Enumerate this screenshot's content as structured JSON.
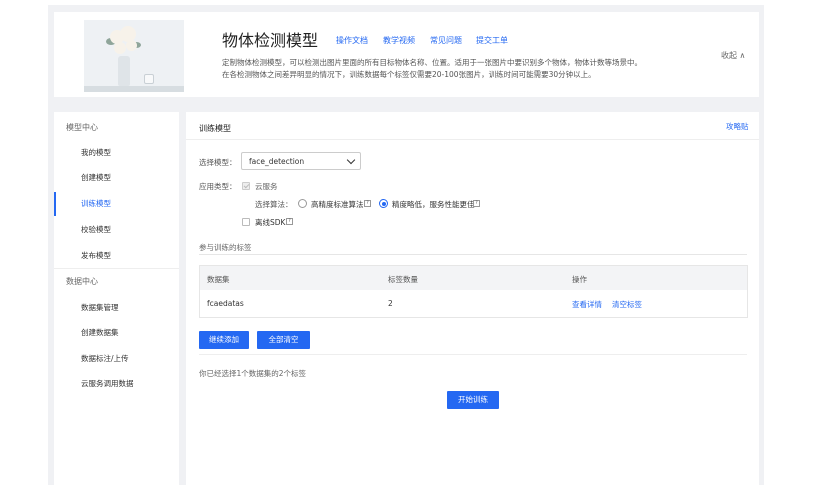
{
  "header": {
    "title": "物体检测模型",
    "links": [
      "操作文档",
      "教学视频",
      "常见问题",
      "提交工单"
    ],
    "description_line1": "定制物体检测模型，可以检测出图片里面的所有目标物体名称、位置。适用于一张图片中要识别多个物体，物体计数等场景中。",
    "description_line2": "在各检测物体之间差异明显的情况下，训练数据每个标签仅需要20-100张图片，训练时间可能需要30分钟以上。",
    "collapse_label": "收起 ∧"
  },
  "sidebar": {
    "section1": "模型中心",
    "items1": [
      "我的模型",
      "创建模型",
      "训练模型",
      "校验模型",
      "发布模型"
    ],
    "section2": "数据中心",
    "items2": [
      "数据集管理",
      "创建数据集",
      "数据标注/上传",
      "云服务调用数据"
    ],
    "active_item": "训练模型"
  },
  "main": {
    "title": "训练模型",
    "help_link": "攻略贴",
    "select_model_label": "选择模型：",
    "select_model_value": "face_detection",
    "app_type_label": "应用类型：",
    "app_type_option": "云服务",
    "algo_label": "选择算法：",
    "algo_option1": "高精度标准算法",
    "algo_option2": "精度略低，服务性能更佳",
    "offline_sdk": "离线SDK",
    "labels_section": "参与训练的标签",
    "table": {
      "headers": [
        "数据集",
        "标签数量",
        "操作"
      ],
      "rows": [
        {
          "dataset": "fcaedatas",
          "count": "2",
          "action1": "查看详情",
          "action2": "清空标签"
        }
      ]
    },
    "btn_add": "继续添加",
    "btn_clear": "全部清空",
    "summary": "你已经选择1个数据集的2个标签",
    "btn_start": "开始训练"
  },
  "colors": {
    "accent": "#2468f2",
    "background": "#f0f1f4"
  }
}
